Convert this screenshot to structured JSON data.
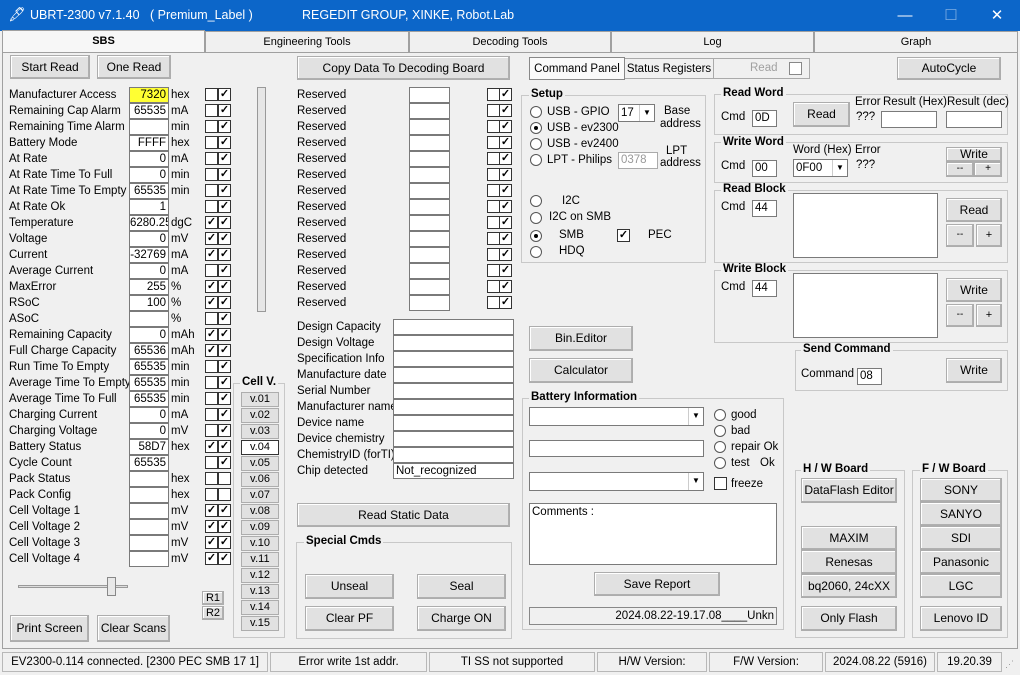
{
  "title": {
    "app": "UBRT-2300 v7.1.40",
    "label": "( Premium_Label )",
    "company": "REGEDIT GROUP,  XINKE,  Robot.Lab"
  },
  "tabs": [
    "SBS",
    "Engineering Tools",
    "Decoding Tools",
    "Log",
    "Graph"
  ],
  "buttons": {
    "start_read": "Start Read",
    "one_read": "One Read",
    "copy_data": "Copy Data To Decoding Board",
    "print_screen": "Print Screen",
    "clear_scans": "Clear Scans",
    "read_static": "Read Static Data",
    "bin_editor": "Bin.Editor",
    "calculator": "Calculator",
    "autocycle": "AutoCycle",
    "save_report": "Save Report",
    "r1": "R1",
    "r2": "R2"
  },
  "sbs_rows": [
    {
      "label": "Manufacturer Access",
      "value": "7320",
      "unit": "hex",
      "c1": "",
      "c2": "✓"
    },
    {
      "label": "Remaining Cap Alarm",
      "value": "65535",
      "unit": "mA",
      "c1": "",
      "c2": "✓"
    },
    {
      "label": "Remaining Time Alarm",
      "value": "",
      "unit": "min",
      "c1": "",
      "c2": "✓"
    },
    {
      "label": "Battery Mode",
      "value": "FFFF",
      "unit": "hex",
      "c1": "",
      "c2": "✓"
    },
    {
      "label": "At Rate",
      "value": "0",
      "unit": "mA",
      "c1": "",
      "c2": "✓"
    },
    {
      "label": "At Rate Time To Full",
      "value": "0",
      "unit": "min",
      "c1": "",
      "c2": "✓"
    },
    {
      "label": "At Rate Time To Empty",
      "value": "65535",
      "unit": "min",
      "c1": "",
      "c2": "✓"
    },
    {
      "label": "At Rate Ok",
      "value": "1",
      "unit": "",
      "c1": "",
      "c2": "✓"
    },
    {
      "label": "Temperature",
      "value": "6280.25",
      "unit": "dgC",
      "c1": "✓",
      "c2": "✓"
    },
    {
      "label": "Voltage",
      "value": "0",
      "unit": "mV",
      "c1": "✓",
      "c2": "✓"
    },
    {
      "label": "Current",
      "value": "-32769",
      "unit": "mA",
      "c1": "✓",
      "c2": "✓"
    },
    {
      "label": "Average Current",
      "value": "0",
      "unit": "mA",
      "c1": "",
      "c2": "✓"
    },
    {
      "label": "MaxError",
      "value": "255",
      "unit": "%",
      "c1": "✓",
      "c2": "✓"
    },
    {
      "label": "RSoC",
      "value": "100",
      "unit": "%",
      "c1": "✓",
      "c2": "✓"
    },
    {
      "label": "ASoC",
      "value": "",
      "unit": "%",
      "c1": "",
      "c2": "✓"
    },
    {
      "label": "Remaining Capacity",
      "value": "0",
      "unit": "mAh",
      "c1": "✓",
      "c2": "✓"
    },
    {
      "label": "Full Charge Capacity",
      "value": "65536",
      "unit": "mAh",
      "c1": "✓",
      "c2": "✓"
    },
    {
      "label": "Run Time To Empty",
      "value": "65535",
      "unit": "min",
      "c1": "",
      "c2": "✓"
    },
    {
      "label": "Average Time To Empty",
      "value": "65535",
      "unit": "min",
      "c1": "",
      "c2": "✓"
    },
    {
      "label": "Average Time To Full",
      "value": "65535",
      "unit": "min",
      "c1": "",
      "c2": "✓"
    },
    {
      "label": "Charging Current",
      "value": "0",
      "unit": "mA",
      "c1": "",
      "c2": "✓"
    },
    {
      "label": "Charging Voltage",
      "value": "0",
      "unit": "mV",
      "c1": "",
      "c2": "✓"
    },
    {
      "label": "Battery Status",
      "value": "58D7",
      "unit": "hex",
      "c1": "✓",
      "c2": "✓"
    },
    {
      "label": "Cycle Count",
      "value": "65535",
      "unit": "",
      "c1": "",
      "c2": "✓"
    },
    {
      "label": "Pack Status",
      "value": "",
      "unit": "hex",
      "c1": "",
      "c2": ""
    },
    {
      "label": "Pack Config",
      "value": "",
      "unit": "hex",
      "c1": "",
      "c2": ""
    },
    {
      "label": "Cell Voltage 1",
      "value": "",
      "unit": "mV",
      "c1": "✓",
      "c2": "✓"
    },
    {
      "label": "Cell Voltage 2",
      "value": "",
      "unit": "mV",
      "c1": "✓",
      "c2": "✓"
    },
    {
      "label": "Cell Voltage 3",
      "value": "",
      "unit": "mV",
      "c1": "✓",
      "c2": "✓"
    },
    {
      "label": "Cell Voltage 4",
      "value": "",
      "unit": "mV",
      "c1": "✓",
      "c2": "✓"
    }
  ],
  "reserved_rows": [
    "Reserved",
    "Reserved",
    "Reserved",
    "Reserved",
    "Reserved",
    "Reserved",
    "Reserved",
    "Reserved",
    "Reserved",
    "Reserved",
    "Reserved",
    "Reserved",
    "Reserved",
    "Reserved"
  ],
  "cellv": {
    "title": "Cell V.",
    "items": [
      "v.01",
      "v.02",
      "v.03",
      "v.04",
      "v.05",
      "v.06",
      "v.07",
      "v.08",
      "v.09",
      "v.10",
      "v.11",
      "v.12",
      "v.13",
      "v.14",
      "v.15"
    ]
  },
  "static_rows": [
    {
      "label": "Design Capacity",
      "value": ""
    },
    {
      "label": "Design Voltage",
      "value": ""
    },
    {
      "label": "Specification Info",
      "value": ""
    },
    {
      "label": "Manufacture date",
      "value": ""
    },
    {
      "label": "Serial Number",
      "value": ""
    },
    {
      "label": "Manufacturer name",
      "value": ""
    },
    {
      "label": "Device name",
      "value": ""
    },
    {
      "label": "Device chemistry",
      "value": ""
    },
    {
      "label": "ChemistryID (forTI)",
      "value": ""
    },
    {
      "label": "Chip detected",
      "value": "Not_recognized"
    }
  ],
  "special": {
    "title": "Special Cmds",
    "unseal": "Unseal",
    "seal": "Seal",
    "clear_pf": "Clear PF",
    "charge_on": "Charge ON"
  },
  "panel_tabs": {
    "command": "Command Panel",
    "status": "Status Registers",
    "read": "Read"
  },
  "setup": {
    "title": "Setup",
    "usb_gpio": "USB - GPIO",
    "usb_ev2300": "USB - ev2300",
    "usb_ev2400": "USB - ev2400",
    "lpt": "LPT - Philips",
    "base_value": "17",
    "base_label1": "Base",
    "base_label2": "address",
    "lpt_value": "0378",
    "lpt_label1": "LPT",
    "lpt_label2": "address",
    "i2c": "I2C",
    "i2c_smb": "I2C on SMB",
    "smb": "SMB",
    "hdq": "HDQ",
    "pec": "PEC"
  },
  "read_word": {
    "title": "Read Word",
    "cmd_label": "Cmd",
    "cmd": "0D",
    "read": "Read",
    "error_label": "Error",
    "error": "???",
    "hex_label": "Result (Hex)",
    "dec_label": "Result (dec)"
  },
  "write_word": {
    "title": "Write Word",
    "cmd_label": "Cmd",
    "cmd": "00",
    "word_label": "Word (Hex)",
    "word": "0F00",
    "error_label": "Error",
    "error": "???",
    "write": "Write",
    "minus": "--",
    "plus": "+"
  },
  "read_block": {
    "title": "Read Block",
    "cmd_label": "Cmd",
    "cmd": "44",
    "read": "Read",
    "minus": "--",
    "plus": "+"
  },
  "write_block": {
    "title": "Write Block",
    "cmd_label": "Cmd",
    "cmd": "44",
    "write": "Write",
    "minus": "--",
    "plus": "+"
  },
  "send_command": {
    "title": "Send Command",
    "label": "Command",
    "value": "08",
    "write": "Write"
  },
  "battery_info": {
    "title": "Battery Information",
    "good": "good",
    "bad": "bad",
    "repair": "repair Ok",
    "test1": "test",
    "test2": "Ok",
    "freeze": "freeze",
    "comments": "Comments :",
    "report_value": "2024.08.22-19.17.08____Unkn"
  },
  "hw_board": {
    "title": "H / W   Board",
    "dataflash": "DataFlash Editor",
    "maxim": "MAXIM",
    "renesas": "Renesas",
    "bq": "bq2060, 24cXX",
    "only_flash": "Only Flash"
  },
  "fw_board": {
    "title": "F / W    Board",
    "sony": "SONY",
    "sanyo": "SANYO",
    "sdi": "SDI",
    "panasonic": "Panasonic",
    "lgc": "LGC",
    "lenovo": "Lenovo ID"
  },
  "status": {
    "conn": "EV2300-0.114 connected. [2300  PEC  SMB  17 1]",
    "err": "Error write 1st addr.",
    "ti": "TI SS not supported",
    "hw": "H/W Version:",
    "fw": "F/W Version:",
    "date": "2024.08.22  (5916)",
    "time": "19.20.39"
  },
  "colors": {
    "highlight": "#ffff33",
    "titlebar": "#0c66c9"
  }
}
